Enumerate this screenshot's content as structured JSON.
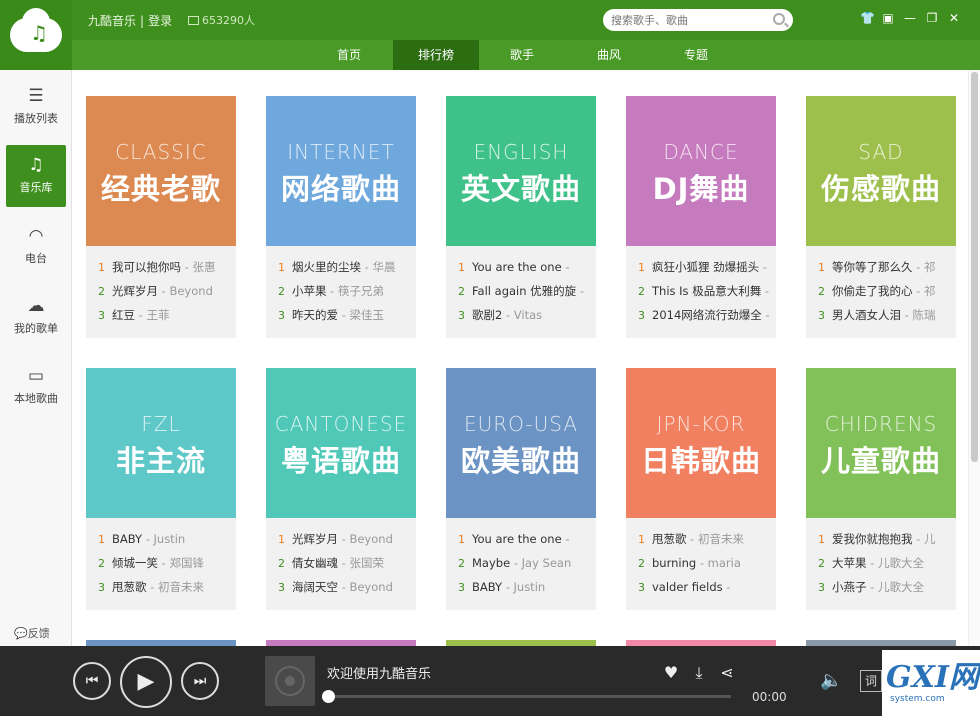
{
  "app": {
    "user_links": [
      "九酷音乐",
      "登录"
    ],
    "online_count": "653290人",
    "search_placeholder": "搜索歌手、歌曲",
    "window_controls": [
      "shirt-icon",
      "mini-mode-icon",
      "minimize-icon",
      "maximize-icon",
      "close-icon"
    ]
  },
  "nav": {
    "tabs": [
      "首页",
      "排行榜",
      "歌手",
      "曲风",
      "专题"
    ],
    "active": "排行榜"
  },
  "sidebar": {
    "items": [
      {
        "label": "播放列表",
        "icon": "list-icon"
      },
      {
        "label": "音乐库",
        "icon": "music-note-icon"
      },
      {
        "label": "电台",
        "icon": "wifi-icon"
      },
      {
        "label": "我的歌单",
        "icon": "cloud-icon"
      },
      {
        "label": "本地歌曲",
        "icon": "monitor-icon"
      }
    ],
    "active": "音乐库",
    "feedback": "反馈"
  },
  "charts": [
    {
      "en": "CLASSIC",
      "zh": "经典老歌",
      "color": "#dd8a52",
      "songs": [
        {
          "title": "我可以抱你吗",
          "artist": "张惠"
        },
        {
          "title": "光辉岁月",
          "artist": "Beyond"
        },
        {
          "title": "红豆",
          "artist": "王菲"
        }
      ]
    },
    {
      "en": "INTERNET",
      "zh": "网络歌曲",
      "color": "#6fa8dc",
      "songs": [
        {
          "title": "烟火里的尘埃",
          "artist": "华晨"
        },
        {
          "title": "小苹果",
          "artist": "筷子兄弟"
        },
        {
          "title": "昨天的爱",
          "artist": "梁佳玉"
        }
      ]
    },
    {
      "en": "ENGLISH",
      "zh": "英文歌曲",
      "color": "#3fc28a",
      "songs": [
        {
          "title": "You are the one",
          "artist": ""
        },
        {
          "title": "Fall again 优雅的旋",
          "artist": ""
        },
        {
          "title": "歌剧2",
          "artist": "Vitas"
        }
      ]
    },
    {
      "en": "DANCE",
      "zh": "DJ舞曲",
      "color": "#c77bbf",
      "songs": [
        {
          "title": "疯狂小狐狸 劲爆摇头",
          "artist": ""
        },
        {
          "title": "This Is 极品意大利舞",
          "artist": ""
        },
        {
          "title": "2014网络流行劲爆全",
          "artist": ""
        }
      ]
    },
    {
      "en": "SAD",
      "zh": "伤感歌曲",
      "color": "#9dc04d",
      "songs": [
        {
          "title": "等你等了那么久",
          "artist": "祁"
        },
        {
          "title": "你偷走了我的心",
          "artist": "祁"
        },
        {
          "title": "男人酒女人泪",
          "artist": "陈瑞"
        }
      ]
    },
    {
      "en": "FZL",
      "zh": "非主流",
      "color": "#5ec8c8",
      "songs": [
        {
          "title": "BABY",
          "artist": "Justin"
        },
        {
          "title": "倾城一笑",
          "artist": "郑国锋"
        },
        {
          "title": "甩葱歌",
          "artist": "初音未来"
        }
      ]
    },
    {
      "en": "CANTONESE",
      "zh": "粤语歌曲",
      "color": "#4fc8b8",
      "songs": [
        {
          "title": "光辉岁月",
          "artist": "Beyond"
        },
        {
          "title": "倩女幽魂",
          "artist": "张国荣"
        },
        {
          "title": "海阔天空",
          "artist": "Beyond"
        }
      ]
    },
    {
      "en": "EURO-USA",
      "zh": "欧美歌曲",
      "color": "#6b93c4",
      "songs": [
        {
          "title": "You are the one",
          "artist": ""
        },
        {
          "title": "Maybe",
          "artist": "Jay Sean"
        },
        {
          "title": "BABY",
          "artist": "Justin"
        }
      ]
    },
    {
      "en": "JPN-KOR",
      "zh": "日韩歌曲",
      "color": "#f0805f",
      "songs": [
        {
          "title": "甩葱歌",
          "artist": "初音未来"
        },
        {
          "title": "burning",
          "artist": "maria"
        },
        {
          "title": "valder fields",
          "artist": ""
        }
      ]
    },
    {
      "en": "CHIDRENS",
      "zh": "儿童歌曲",
      "color": "#82c15a",
      "songs": [
        {
          "title": "爱我你就抱抱我",
          "artist": "儿"
        },
        {
          "title": "大苹果",
          "artist": "儿歌大全"
        },
        {
          "title": "小燕子",
          "artist": "儿歌大全"
        }
      ]
    }
  ],
  "stub_colors": [
    "#6b93c4",
    "#c77bbf",
    "#9dc04d",
    "#f08aa8",
    "#8a9aa8"
  ],
  "player": {
    "now_playing": "欢迎使用九酷音乐",
    "time": "00:00",
    "progress": 0,
    "lyric_label": "词"
  },
  "watermark": {
    "main": "GXI网",
    "sub": "system.com"
  }
}
